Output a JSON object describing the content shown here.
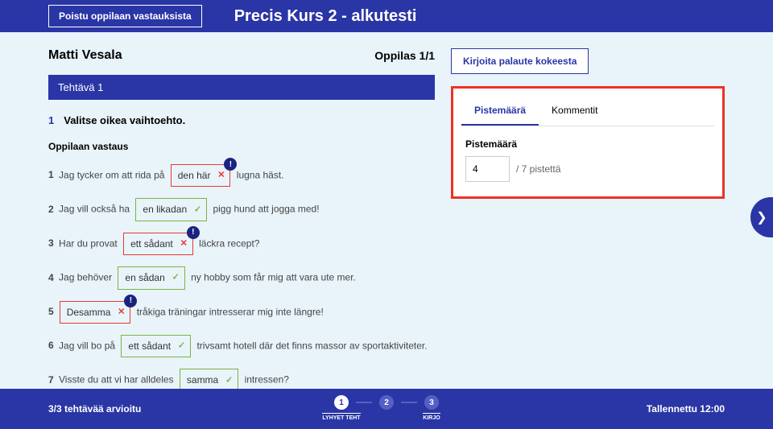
{
  "header": {
    "exit_label": "Poistu oppilaan vastauksista",
    "title": "Precis Kurs 2 - alkutesti"
  },
  "student": {
    "name": "Matti Vesala",
    "count": "Oppilas 1/1"
  },
  "feedback_button": "Kirjoita palaute kokeesta",
  "task": {
    "header": "Tehtävä 1",
    "number": "1",
    "prompt": "Valitse oikea vaihtoehto.",
    "answer_label": "Oppilaan vastaus",
    "items": [
      {
        "num": "1",
        "pre": "Jag tycker om att rida på",
        "ans": "den här",
        "status": "wrong",
        "flag": true,
        "post": "lugna häst."
      },
      {
        "num": "2",
        "pre": "Jag vill också ha",
        "ans": "en likadan",
        "status": "correct",
        "flag": false,
        "post": "pigg hund att jogga med!"
      },
      {
        "num": "3",
        "pre": "Har du provat",
        "ans": "ett sådant",
        "status": "wrong",
        "flag": true,
        "post": "läckra recept?"
      },
      {
        "num": "4",
        "pre": "Jag behöver",
        "ans": "en sådan",
        "status": "correct",
        "flag": false,
        "post": "ny hobby som får mig att vara ute mer."
      },
      {
        "num": "5",
        "pre": "",
        "ans": "Desamma",
        "status": "wrong",
        "flag": true,
        "post": "tråkiga träningar intresserar mig inte längre!"
      },
      {
        "num": "6",
        "pre": "Jag vill bo på",
        "ans": "ett sådant",
        "status": "correct",
        "flag": false,
        "post": "trivsamt hotell där det finns massor av sportaktiviteter."
      },
      {
        "num": "7",
        "pre": "Visste du att vi har alldeles",
        "ans": "samma",
        "status": "correct",
        "flag": false,
        "post": "intressen?"
      }
    ]
  },
  "score_panel": {
    "tab_score": "Pistemäärä",
    "tab_comments": "Kommentit",
    "label": "Pistemäärä",
    "value": "4",
    "max": "/ 7 pistettä"
  },
  "footer": {
    "progress": "3/3 tehtävää arvioitu",
    "saved": "Tallennettu 12:00",
    "steps": [
      {
        "num": "1",
        "label": "LYHYET TEHT",
        "active": true
      },
      {
        "num": "2",
        "label": "",
        "active": false
      },
      {
        "num": "3",
        "label": "KIRJO",
        "active": false
      }
    ]
  },
  "marks": {
    "correct": "✓",
    "wrong": "✕",
    "flag": "!"
  },
  "arrow": "❯"
}
